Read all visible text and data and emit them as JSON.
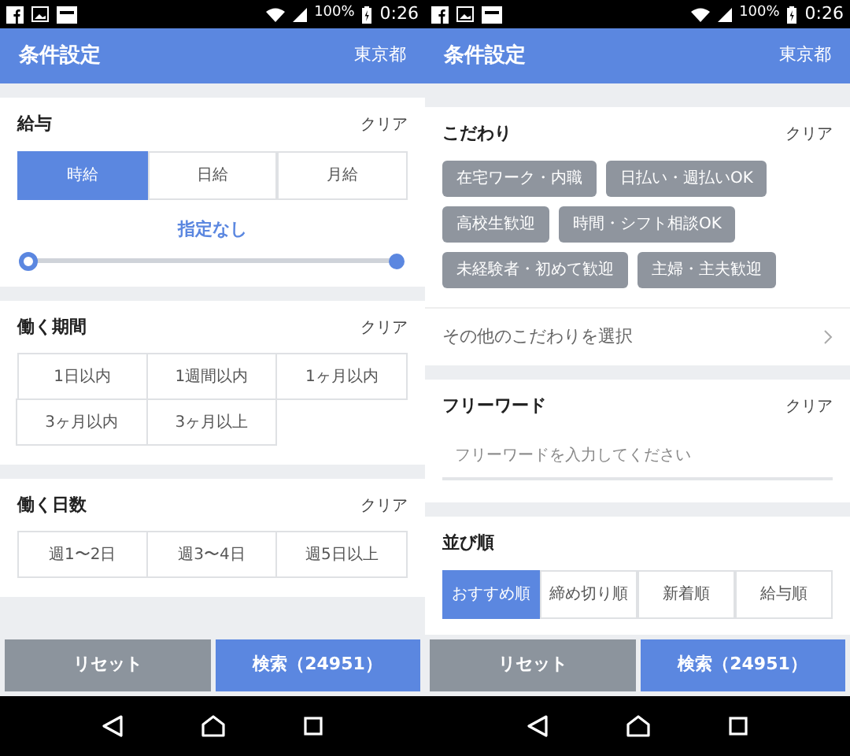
{
  "screens": [
    {
      "status_bar": {
        "battery": "100%",
        "time": "0:26"
      },
      "header": {
        "title": "条件設定",
        "location": "東京都"
      },
      "sections": [
        {
          "kind": "salary",
          "title": "給与",
          "clear": "クリア",
          "options": [
            {
              "label": "時給",
              "selected": true
            },
            {
              "label": "日給",
              "selected": false
            },
            {
              "label": "月給",
              "selected": false
            }
          ],
          "reading": "指定なし",
          "thumbs": [
            {
              "level": 0
            },
            {
              "level": 1
            }
          ]
        },
        {
          "kind": "grid",
          "title": "働く期間",
          "clear": "クリア",
          "options": [
            {
              "label": "1日以内",
              "selected": false
            },
            {
              "label": "1週間以内",
              "selected": false
            },
            {
              "label": "1ヶ月以内",
              "selected": false
            },
            {
              "label": "3ヶ月以内",
              "selected": false
            },
            {
              "label": "3ヶ月以上",
              "selected": false
            }
          ]
        },
        {
          "kind": "grid",
          "title": "働く日数",
          "clear": "クリア",
          "options": [
            {
              "label": "週1〜2日",
              "selected": false
            },
            {
              "label": "週3〜4日",
              "selected": false
            },
            {
              "label": "週5日以上",
              "selected": false
            }
          ]
        }
      ],
      "buttons": {
        "reset": "リセット",
        "search": "検索（24951）"
      }
    },
    {
      "status_bar": {
        "battery": "100%",
        "time": "0:26"
      },
      "header": {
        "title": "条件設定",
        "location": "東京都"
      },
      "sections": [
        {
          "kind": "tags",
          "title": "こだわり",
          "clear": "クリア",
          "tags": [
            {
              "label": "在宅ワーク・内職",
              "selected": false
            },
            {
              "label": "日払い・週払いOK",
              "selected": false
            },
            {
              "label": "高校生歓迎",
              "selected": false
            },
            {
              "label": "時間・シフト相談OK",
              "selected": false
            },
            {
              "label": "未経験者・初めて歓迎",
              "selected": false
            },
            {
              "label": "主婦・主夫歓迎",
              "selected": false
            }
          ],
          "more": "その他のこだわりを選択"
        },
        {
          "kind": "freeword",
          "title": "フリーワード",
          "clear": "クリア",
          "placeholder": "フリーワードを入力してください"
        },
        {
          "kind": "segmented",
          "title": "並び順",
          "options": [
            {
              "label": "おすすめ順",
              "selected": true
            },
            {
              "label": "締め切り順",
              "selected": false
            },
            {
              "label": "新着順",
              "selected": false
            },
            {
              "label": "給与順",
              "selected": false
            }
          ]
        }
      ],
      "buttons": {
        "reset": "リセット",
        "search": "検索（24951）"
      }
    }
  ]
}
